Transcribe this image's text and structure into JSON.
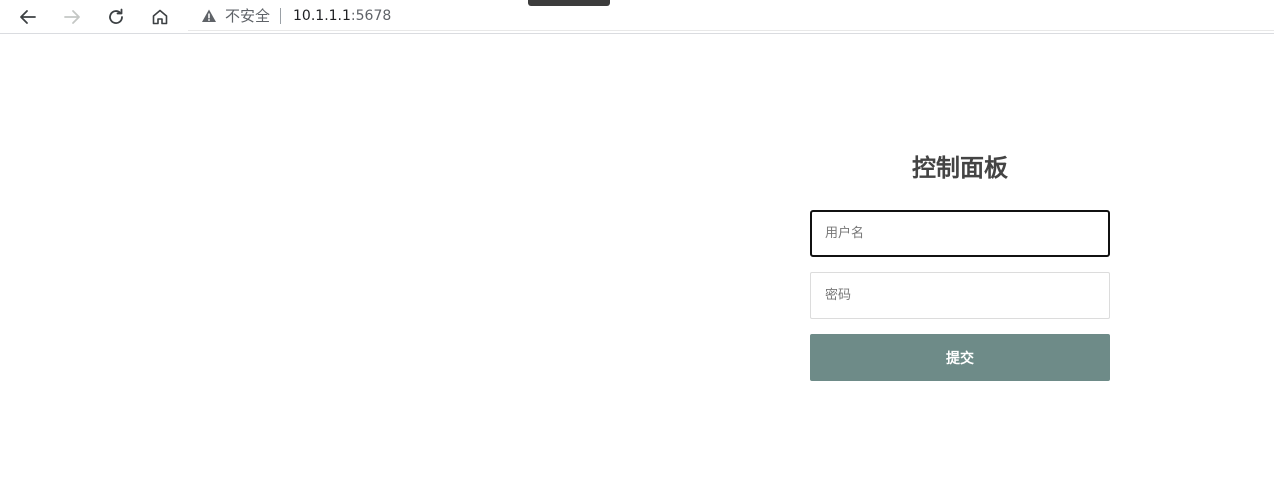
{
  "browser": {
    "security_label": "不安全",
    "url_host": "10.1.1.1",
    "url_port": ":5678",
    "icons": {
      "back": "arrow-left-icon",
      "forward": "arrow-right-icon",
      "reload": "reload-icon",
      "home": "home-icon",
      "warning": "warning-triangle-icon"
    }
  },
  "login": {
    "title": "控制面板",
    "username_placeholder": "用户名",
    "password_placeholder": "密码",
    "submit_label": "提交",
    "button_color": "#6e8b88"
  }
}
